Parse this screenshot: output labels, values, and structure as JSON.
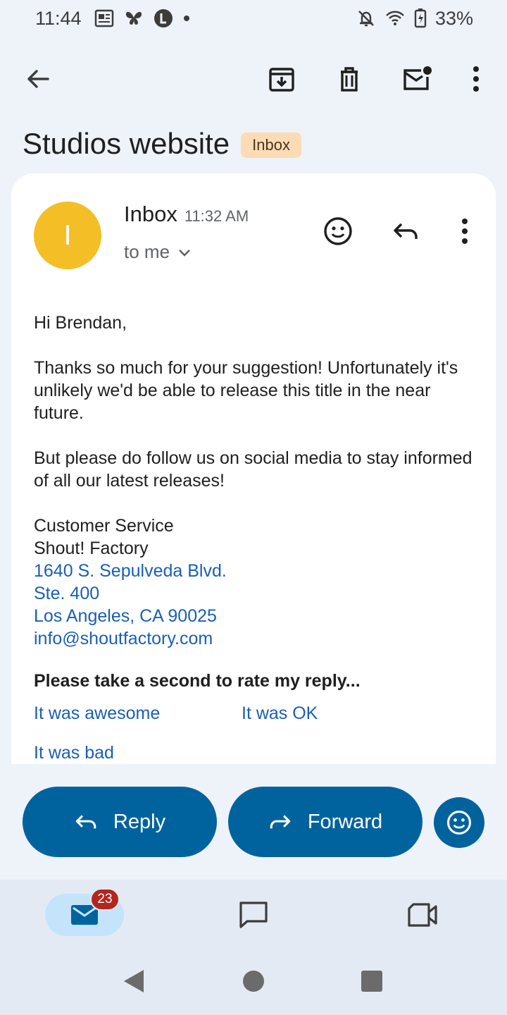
{
  "status_bar": {
    "time": "11:44",
    "battery": "33%",
    "left_icons": [
      "news-icon",
      "butterfly-icon",
      "l-circle-icon",
      "dot-icon"
    ],
    "right_icons": [
      "bell-off-icon",
      "wifi-icon",
      "battery-charging-icon"
    ]
  },
  "toolbar": {
    "icons": [
      "back-arrow-icon",
      "archive-icon",
      "delete-icon",
      "mark-unread-icon",
      "more-vert-icon"
    ]
  },
  "email": {
    "subject": "Studios website",
    "label": "Inbox",
    "avatar_letter": "I",
    "avatar_color": "#f4bf26",
    "sender": "Inbox",
    "time": "11:32 AM",
    "recipient": "to me",
    "greeting": "Hi Brendan,",
    "paragraph1": "Thanks so much for your suggestion! Unfortunately it's unlikely we'd be able to release this title in the near future.",
    "paragraph2": "But please do follow us on social media to stay informed of all our latest releases!",
    "signature": {
      "line1": "Customer Service",
      "line2": "Shout! Factory",
      "address1": "1640 S. Sepulveda Blvd.",
      "address2": "Ste. 400",
      "address3": "Los Angeles, CA 90025",
      "email": "info@shoutfactory.com"
    },
    "rating": {
      "question": "Please take a second to rate my reply...",
      "options": [
        "It was awesome",
        "It was OK",
        "It was bad"
      ]
    }
  },
  "actions": {
    "reply": "Reply",
    "forward": "Forward"
  },
  "bottom_nav": {
    "mail_badge": "23",
    "items": [
      "mail-icon",
      "chat-icon",
      "meet-icon"
    ]
  },
  "colors": {
    "accent": "#01639e",
    "link": "#1a5fb4",
    "label_chip": "#fddcb5",
    "badge": "#b3261e",
    "background": "#eef2f9"
  }
}
